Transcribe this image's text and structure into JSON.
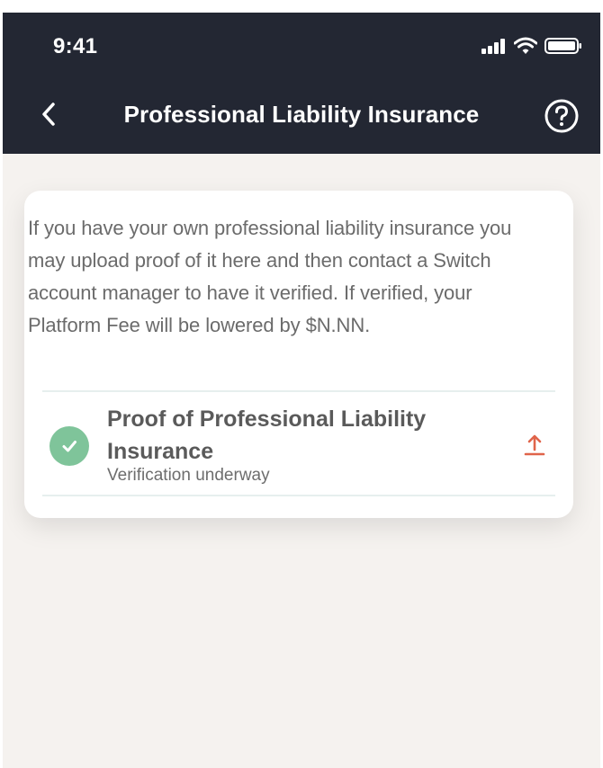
{
  "status_bar": {
    "time": "9:41",
    "icons": [
      "signal-icon",
      "wifi-icon",
      "battery-icon"
    ]
  },
  "nav": {
    "back_icon": "chevron-left-icon",
    "title": "Professional Liability Insurance",
    "help_icon": "question-circle-icon"
  },
  "card": {
    "description": "If you have your own professional liability insurance you may upload proof of it here and then contact a Switch account manager to have it verified. If verified, your Platform Fee will be lowered by $N.NN.",
    "document": {
      "title": "Proof of Professional Liability Insurance",
      "status": "Verification underway",
      "status_icon": "check-circle-icon",
      "action_icon": "upload-icon"
    }
  },
  "colors": {
    "header_bg": "#232733",
    "page_bg": "#f5f2ef",
    "success": "#7fc49a",
    "accent": "#e0644a"
  }
}
